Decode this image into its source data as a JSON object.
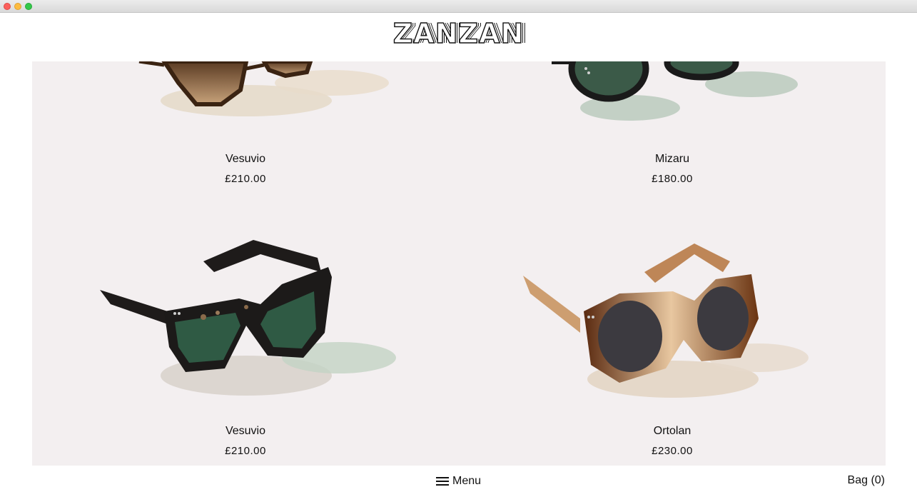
{
  "brand": {
    "logo": "ZANZAN"
  },
  "products": [
    {
      "name": "Vesuvio",
      "price": "£210.00",
      "frame": "tortoise",
      "lens": "brown"
    },
    {
      "name": "Mizaru",
      "price": "£180.00",
      "frame": "black",
      "lens": "green"
    },
    {
      "name": "Vesuvio",
      "price": "£210.00",
      "frame": "black",
      "lens": "green"
    },
    {
      "name": "Ortolan",
      "price": "£230.00",
      "frame": "amber",
      "lens": "grey"
    }
  ],
  "footer": {
    "menu_label": "Menu",
    "bag_label": "Bag (0)"
  },
  "colors": {
    "grid_background": "#f3eff0",
    "text": "#111111"
  }
}
